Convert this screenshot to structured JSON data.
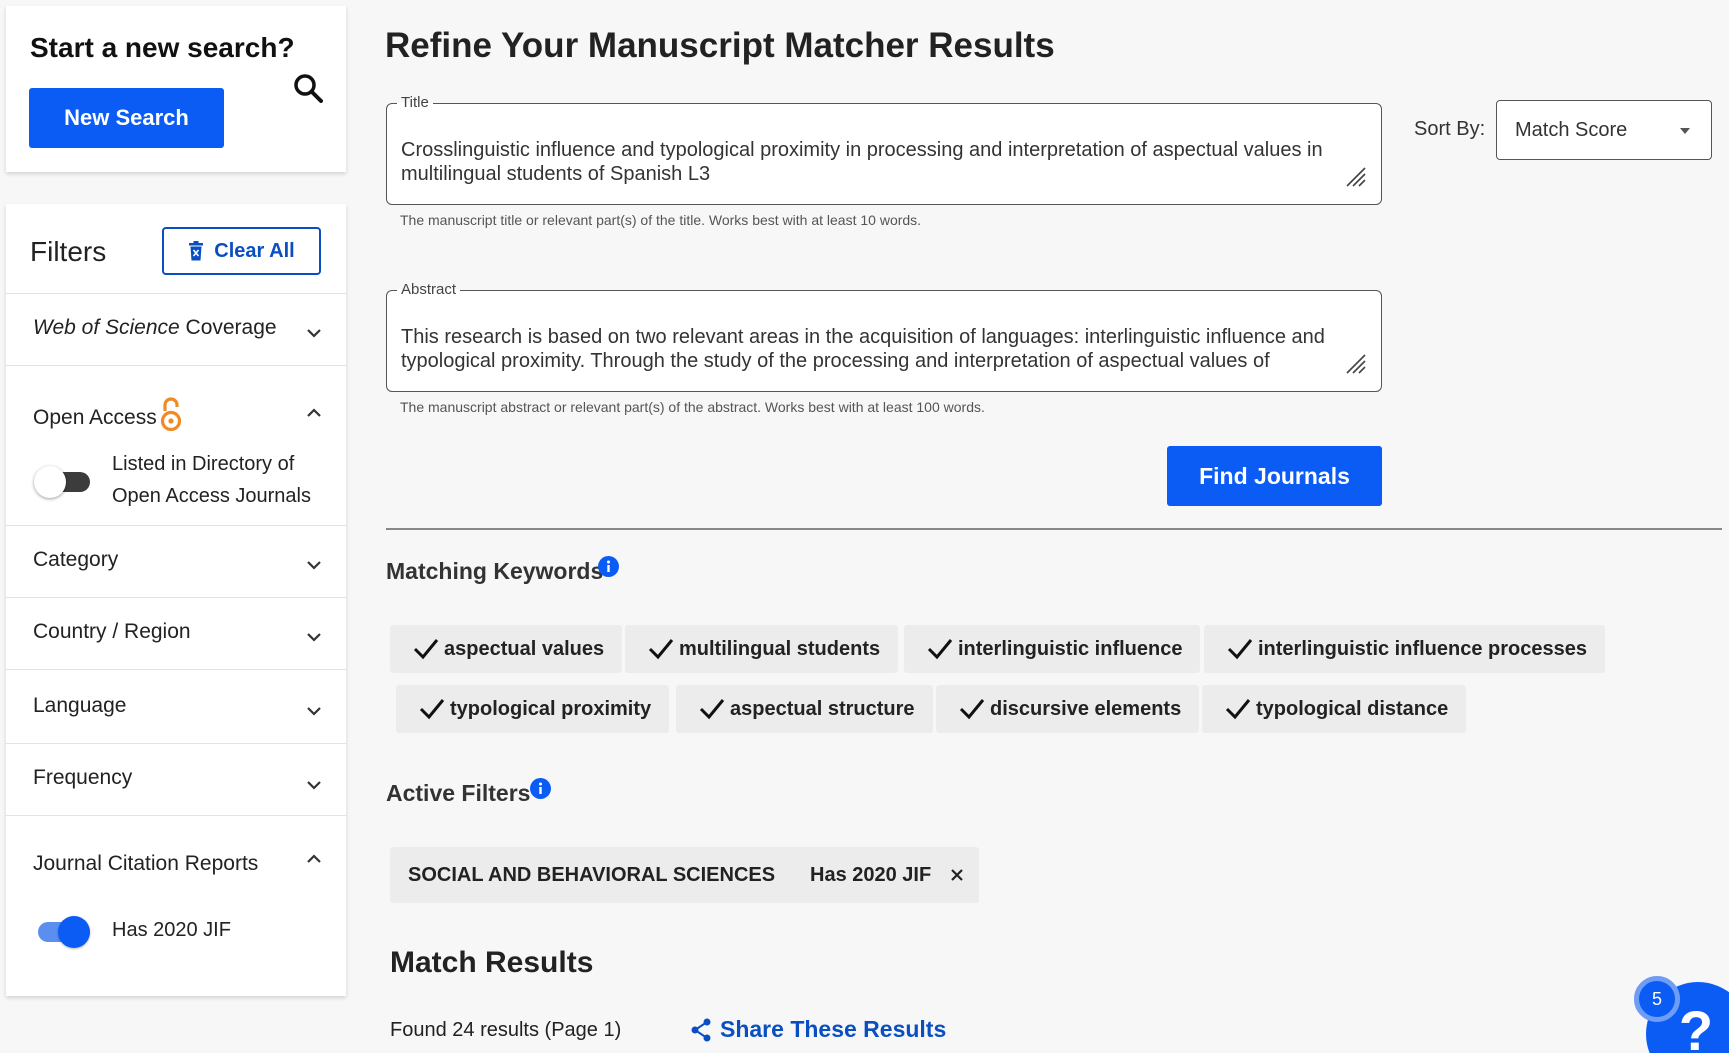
{
  "sidebar": {
    "search_heading": "Start a new search?",
    "new_search_label": "New Search",
    "filters_title": "Filters",
    "clear_all_label": "Clear All",
    "wos_label_italic": "Web of Science",
    "wos_label_rest": " Coverage",
    "open_access_label": "Open Access",
    "doaj_label_line1": "Listed in Directory of",
    "doaj_label_line2": "Open Access Journals",
    "doaj_toggle_on": false,
    "category_label": "Category",
    "country_label": "Country / Region",
    "language_label": "Language",
    "frequency_label": "Frequency",
    "jcr_label": "Journal Citation Reports",
    "jif_label": "Has 2020 JIF",
    "jif_toggle_on": true
  },
  "main": {
    "page_title": "Refine Your Manuscript Matcher Results",
    "title_field": {
      "legend": "Title",
      "value": "Crosslinguistic influence and typological proximity in processing and interpretation of aspectual values in multilingual students of Spanish L3",
      "helper": "The manuscript title or relevant part(s) of the title. Works best with at least 10 words."
    },
    "abstract_field": {
      "legend": "Abstract",
      "value": "This research is based on two relevant areas in the acquisition of languages: interlinguistic influence and typological proximity. Through the study of the processing and interpretation of aspectual values of",
      "helper": "The manuscript abstract or relevant part(s) of the abstract. Works best with at least 100 words."
    },
    "sort_label": "Sort By:",
    "sort_value": "Match Score",
    "find_journals_label": "Find Journals",
    "matching_keywords_title": "Matching Keywords",
    "keywords": [
      "aspectual values",
      "multilingual students",
      "interlinguistic influence",
      "interlinguistic influence processes",
      "typological proximity",
      "aspectual structure",
      "discursive elements",
      "typological distance"
    ],
    "active_filters_title": "Active Filters",
    "active_filters": [
      "SOCIAL AND BEHAVIORAL SCIENCES",
      "Has 2020 JIF"
    ],
    "match_results_title": "Match Results",
    "results_count": "Found 24 results (Page 1)",
    "share_label": "Share These Results",
    "help_badge_count": "5"
  },
  "colors": {
    "primary": "#0a5cf5",
    "link": "#0a4fc2",
    "open_access": "#f08a24",
    "chip_bg": "#ececec"
  }
}
